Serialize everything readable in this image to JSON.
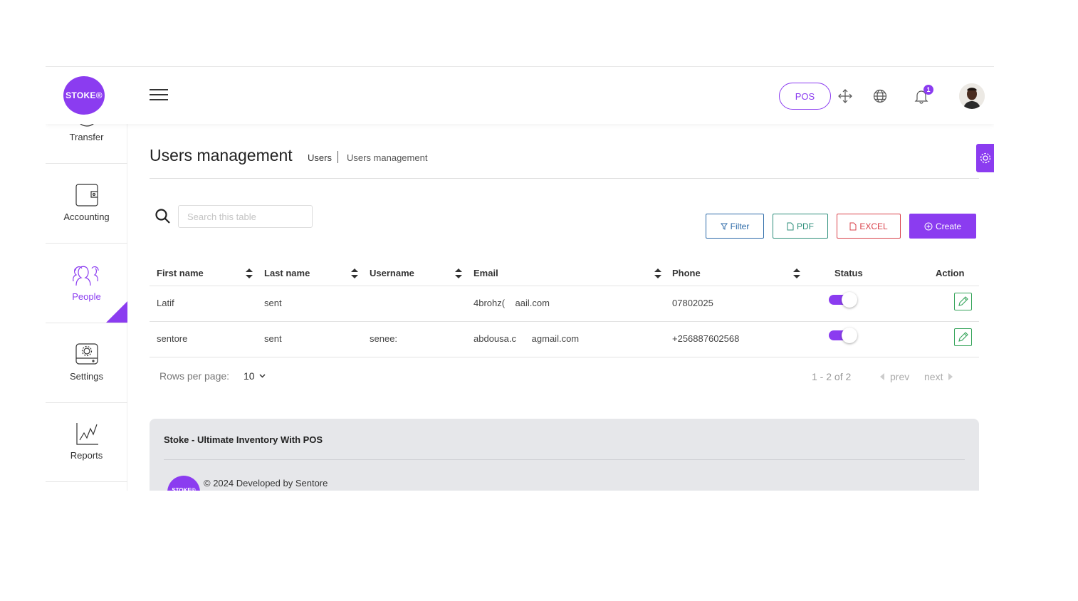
{
  "brand": {
    "logo_text": "STOKE®",
    "accent": "#8b3cf0"
  },
  "header": {
    "pos_label": "POS",
    "icons": [
      "menu-icon",
      "fullscreen-icon",
      "globe-icon",
      "bell-icon"
    ],
    "notification_count": "1"
  },
  "sidebar": {
    "items": [
      {
        "label": "Transfer",
        "icon": "transfer-icon",
        "active": false
      },
      {
        "label": "Accounting",
        "icon": "wallet-icon",
        "active": false
      },
      {
        "label": "People",
        "icon": "people-icon",
        "active": true
      },
      {
        "label": "Settings",
        "icon": "settings-icon",
        "active": false
      },
      {
        "label": "Reports",
        "icon": "chart-icon",
        "active": false
      }
    ]
  },
  "page": {
    "title": "Users management",
    "breadcrumb": {
      "parent": "Users",
      "current": "Users management"
    }
  },
  "toolbar": {
    "search_placeholder": "Search this table",
    "filter_label": "Filter",
    "pdf_label": "PDF",
    "excel_label": "EXCEL",
    "create_label": "Create"
  },
  "table": {
    "columns": [
      "First name",
      "Last name",
      "Username",
      "Email",
      "Phone",
      "Status",
      "Action"
    ],
    "rows": [
      {
        "first": "Latif",
        "last": "sent",
        "username": "",
        "email": "4brohz(    aail.com",
        "phone": "07802025",
        "status": true
      },
      {
        "first": "sentore",
        "last": "sent",
        "username": "senee:",
        "email": "abdousa.c      agmail.com",
        "phone": "+256887602568",
        "status": true
      }
    ]
  },
  "pagination": {
    "rows_label": "Rows per page:",
    "rows_value": "10",
    "info": "1 - 2 of 2",
    "prev": "prev",
    "next": "next"
  },
  "footer": {
    "title": "Stoke - Ultimate Inventory With POS",
    "copyright": "© 2024 Developed by Sentore",
    "logo_text": "STOKE®"
  }
}
